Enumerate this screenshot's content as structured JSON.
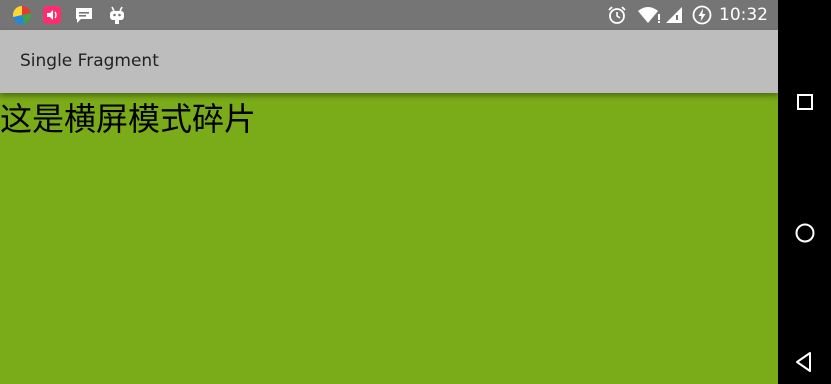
{
  "status_bar": {
    "time": "10:32",
    "left_icons": [
      "app-launcher-icon",
      "pink-app-icon",
      "chat-notification-icon",
      "android-debug-icon"
    ],
    "right_icons": [
      "alarm-icon",
      "wifi-icon",
      "cell-signal-icon",
      "battery-charging-icon"
    ]
  },
  "action_bar": {
    "title": "Single Fragment"
  },
  "content": {
    "fragment_text": "这是横屏模式碎片",
    "background_color": "#7aab19"
  },
  "nav_bar": {
    "buttons": [
      "recents-button",
      "home-button",
      "back-button"
    ]
  }
}
